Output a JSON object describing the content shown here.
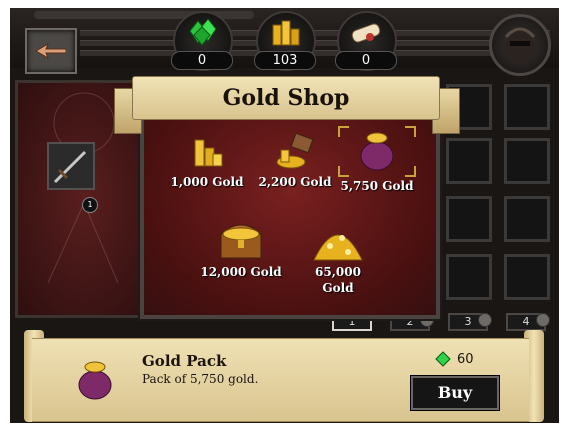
{
  "topbar": {
    "title_strip_text": "Gold Shop",
    "resources": [
      {
        "name": "gems",
        "value": "0",
        "icon": "emerald-gems-icon"
      },
      {
        "name": "gold",
        "value": "103",
        "icon": "gold-coins-icon"
      },
      {
        "name": "scrolls",
        "value": "0",
        "icon": "scroll-icon"
      }
    ]
  },
  "inventory": {
    "slot_badge": "1",
    "pages": [
      "1",
      "2",
      "3",
      "4"
    ]
  },
  "shop": {
    "title": "Gold Shop",
    "items": [
      {
        "label": "1,000 Gold",
        "icon": "small-coin-stack-icon"
      },
      {
        "label": "2,200 Gold",
        "icon": "coin-pile-icon"
      },
      {
        "label": "5,750 Gold",
        "icon": "gold-sack-icon"
      },
      {
        "label": "12,000 Gold",
        "icon": "treasure-chest-icon"
      },
      {
        "label": "65,000",
        "label2": "Gold",
        "icon": "gold-hoard-icon"
      }
    ]
  },
  "details": {
    "title": "Gold Pack",
    "description": "Pack of 5,750 gold.",
    "price": "60",
    "price_icon": "emerald-icon",
    "buy_label": "Buy"
  },
  "colors": {
    "accent_gold": "#e8b21f",
    "gem_green": "#2fd24a",
    "shop_red": "#6e1c1c",
    "parchment": "#e6d4a3"
  }
}
